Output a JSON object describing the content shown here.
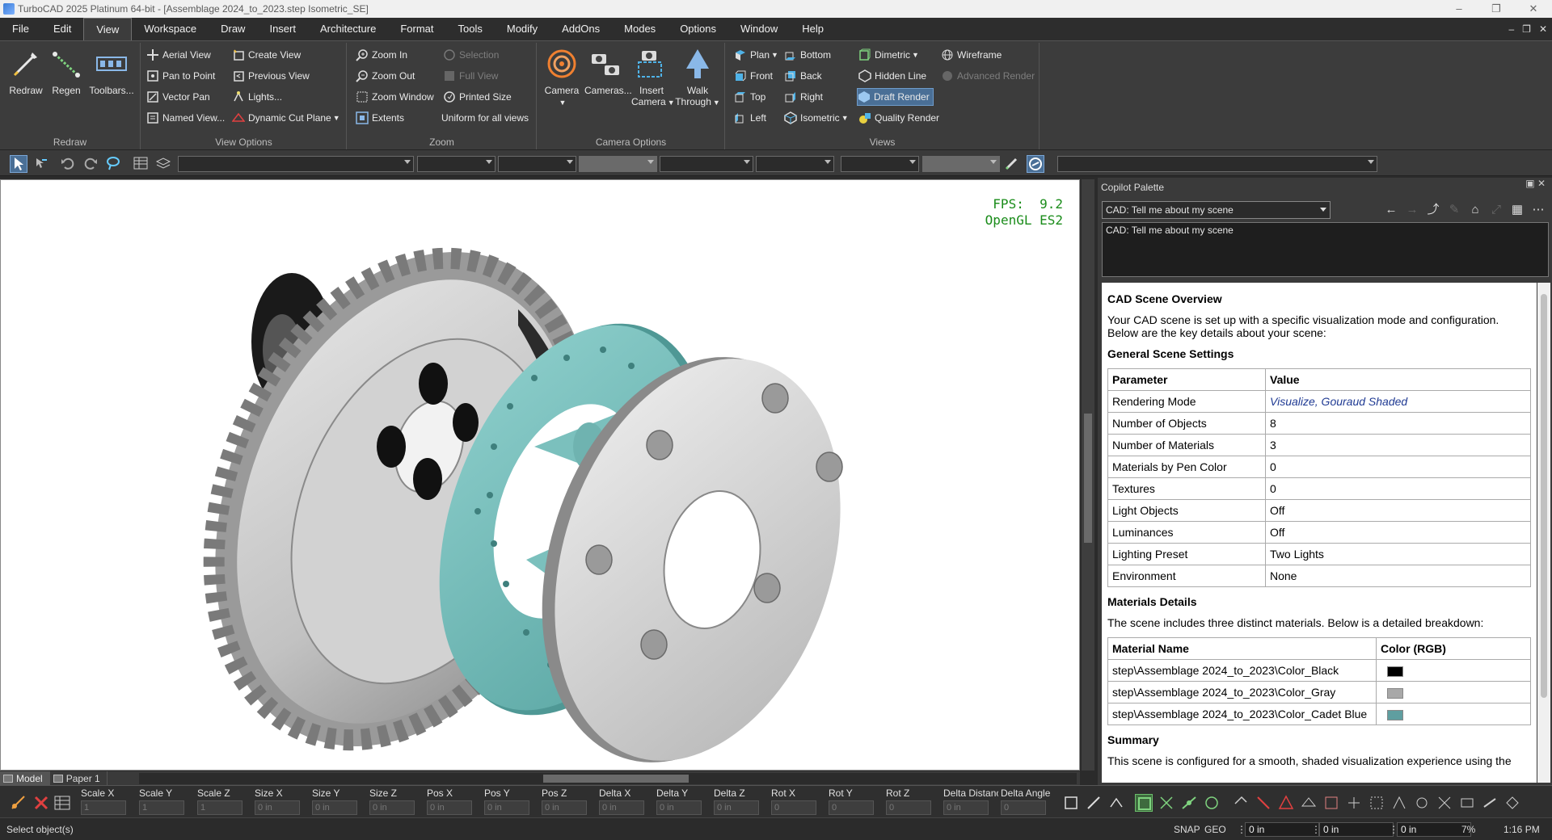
{
  "window": {
    "title": "TurboCAD 2025 Platinum 64-bit - [Assemblage 2024_to_2023.step Isometric_SE]"
  },
  "menu": [
    "File",
    "Edit",
    "View",
    "Workspace",
    "Draw",
    "Insert",
    "Architecture",
    "Format",
    "Tools",
    "Modify",
    "AddOns",
    "Modes",
    "Options",
    "Window",
    "Help"
  ],
  "ribbon": {
    "groups": {
      "redraw": "Redraw",
      "view_options": "View Options",
      "zoom": "Zoom",
      "camera_options": "Camera Options",
      "views": "Views"
    },
    "redraw": {
      "redraw": "Redraw",
      "regen": "Regen",
      "toolbars": "Toolbars..."
    },
    "view_options": {
      "aerial_view": "Aerial View",
      "pan_to_point": "Pan to Point",
      "vector_pan": "Vector Pan",
      "named_view": "Named View...",
      "create_view": "Create View",
      "previous_view": "Previous View",
      "lights": "Lights...",
      "dynamic_cut_plane": "Dynamic Cut Plane"
    },
    "zoom": {
      "zoom_in": "Zoom In",
      "zoom_out": "Zoom Out",
      "zoom_window": "Zoom Window",
      "extents": "Extents",
      "selection": "Selection",
      "full_view": "Full View",
      "printed_size": "Printed Size",
      "uniform": "Uniform for all views"
    },
    "camera": {
      "camera": "Camera",
      "cameras": "Cameras...",
      "insert_camera_1": "Insert",
      "insert_camera_2": "Camera",
      "walk_through_1": "Walk",
      "walk_through_2": "Through"
    },
    "views": {
      "plan": "Plan",
      "front": "Front",
      "top": "Top",
      "left": "Left",
      "bottom": "Bottom",
      "back": "Back",
      "right": "Right",
      "isometric": "Isometric",
      "dimetric": "Dimetric",
      "hidden_line": "Hidden Line",
      "draft_render": "Draft Render",
      "quality_render": "Quality Render",
      "wireframe": "Wireframe",
      "advanced_render": "Advanced Render"
    }
  },
  "viewport": {
    "fps_label": "FPS:",
    "fps_value": "9.2",
    "renderer": "OpenGL ES2"
  },
  "tabs": [
    "Model",
    "Paper 1"
  ],
  "copilot": {
    "title": "Copilot Palette",
    "select_value": "CAD: Tell me about my scene",
    "prompt_text": "CAD: Tell me about my scene",
    "response": {
      "heading": "CAD Scene Overview",
      "intro": "Your CAD scene is set up with a specific visualization mode and configuration. Below are the key details about your scene:",
      "general_heading": "General Scene Settings",
      "general_cols": [
        "Parameter",
        "Value"
      ],
      "general_rows": [
        [
          "Rendering Mode",
          "Visualize, Gouraud Shaded"
        ],
        [
          "Number of Objects",
          "8"
        ],
        [
          "Number of Materials",
          "3"
        ],
        [
          "Materials by Pen Color",
          "0"
        ],
        [
          "Textures",
          "0"
        ],
        [
          "Light Objects",
          "Off"
        ],
        [
          "Luminances",
          "Off"
        ],
        [
          "Lighting Preset",
          "Two Lights"
        ],
        [
          "Environment",
          "None"
        ]
      ],
      "materials_heading": "Materials Details",
      "materials_intro": "The scene includes three distinct materials. Below is a detailed breakdown:",
      "materials_cols": [
        "Material Name",
        "Color (RGB)"
      ],
      "materials_rows": [
        {
          "name": "step\\Assemblage 2024_to_2023\\Color_Black",
          "color": "#000000"
        },
        {
          "name": "step\\Assemblage 2024_to_2023\\Color_Gray",
          "color": "#a8a8a8"
        },
        {
          "name": "step\\Assemblage 2024_to_2023\\Color_Cadet Blue",
          "color": "#5f9ea0"
        }
      ],
      "summary_heading": "Summary",
      "summary_text": "This scene is configured for a smooth, shaded visualization experience using the"
    }
  },
  "inspector": {
    "fields": [
      "Scale X",
      "Scale Y",
      "Scale Z",
      "Size X",
      "Size Y",
      "Size Z",
      "Pos X",
      "Pos Y",
      "Pos Z",
      "Delta X",
      "Delta Y",
      "Delta Z",
      "Rot X",
      "Rot Y",
      "Rot Z",
      "Delta Distance",
      "Delta Angle"
    ],
    "placeholders": [
      "1",
      "1",
      "1",
      "0 in",
      "0 in",
      "0 in",
      "0 in",
      "0 in",
      "0 in",
      "0 in",
      "0 in",
      "0 in",
      "0",
      "0",
      "0",
      "0 in",
      "0"
    ]
  },
  "status": {
    "message": "Select object(s)",
    "snap": "SNAP",
    "geo": "GEO",
    "x_value": "0 in",
    "y_value": "0 in",
    "z_value": "0 in",
    "zoom": "7%",
    "time": "1:16 PM"
  },
  "colors": {
    "gear_gray": "#c8c8c8",
    "cadet_blue": "#6fb3b0",
    "fps_green": "#1a8c1a",
    "highlight": "#4a6f96"
  }
}
